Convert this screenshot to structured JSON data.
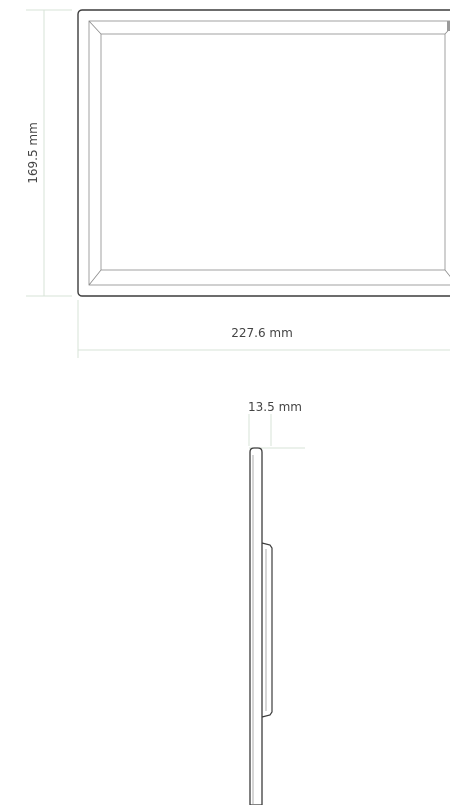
{
  "dimensions": {
    "height": "169.5 mm",
    "width": "227.6 mm",
    "depth": "13.5 mm"
  },
  "colors": {
    "outline": "#3c3c3c",
    "inner_line": "#8a8a8a",
    "dimension_line": "#d7e3d7",
    "text": "#444444"
  }
}
